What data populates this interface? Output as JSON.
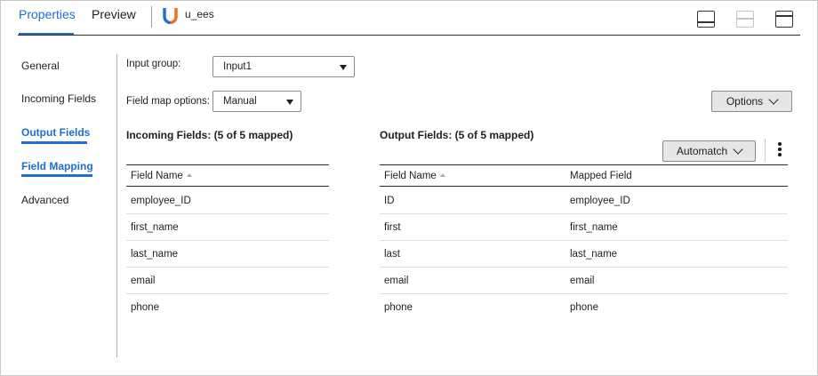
{
  "tabs": {
    "properties": "Properties",
    "preview": "Preview",
    "object_name": "u_ees"
  },
  "icons": {
    "logo": "union-transformation-icon",
    "view_bottom": "panel-bottom-icon",
    "view_split": "panel-split-icon",
    "view_top": "panel-top-icon",
    "menu": "kebab-menu-icon",
    "sort": "sort-ascending-icon",
    "caret": "caret-down-icon",
    "chevron": "chevron-down-icon"
  },
  "colors": {
    "accent": "#1f6fd1",
    "logo_blue": "#1f6fd1",
    "logo_orange": "#f26b21"
  },
  "nav": {
    "items": [
      {
        "label": "General",
        "active": false
      },
      {
        "label": "Incoming Fields",
        "active": false
      },
      {
        "label": "Output Fields",
        "active": true
      },
      {
        "label": "Field Mapping",
        "active": true
      },
      {
        "label": "Advanced",
        "active": false
      }
    ]
  },
  "form": {
    "input_group_label": "Input group:",
    "input_group_value": "Input1",
    "field_map_label": "Field map options:",
    "field_map_value": "Manual",
    "options_button": "Options",
    "automatch_button": "Automatch"
  },
  "incoming": {
    "title": "Incoming Fields: (5 of 5 mapped)",
    "column": "Field Name",
    "rows": [
      "employee_ID",
      "first_name",
      "last_name",
      "email",
      "phone"
    ]
  },
  "output": {
    "title": "Output Fields: (5 of 5 mapped)",
    "columns": [
      "Field Name",
      "Mapped Field"
    ],
    "rows": [
      {
        "field": "ID",
        "mapped": "employee_ID"
      },
      {
        "field": "first",
        "mapped": "first_name"
      },
      {
        "field": "last",
        "mapped": "last_name"
      },
      {
        "field": "email",
        "mapped": "email"
      },
      {
        "field": "phone",
        "mapped": "phone"
      }
    ]
  }
}
